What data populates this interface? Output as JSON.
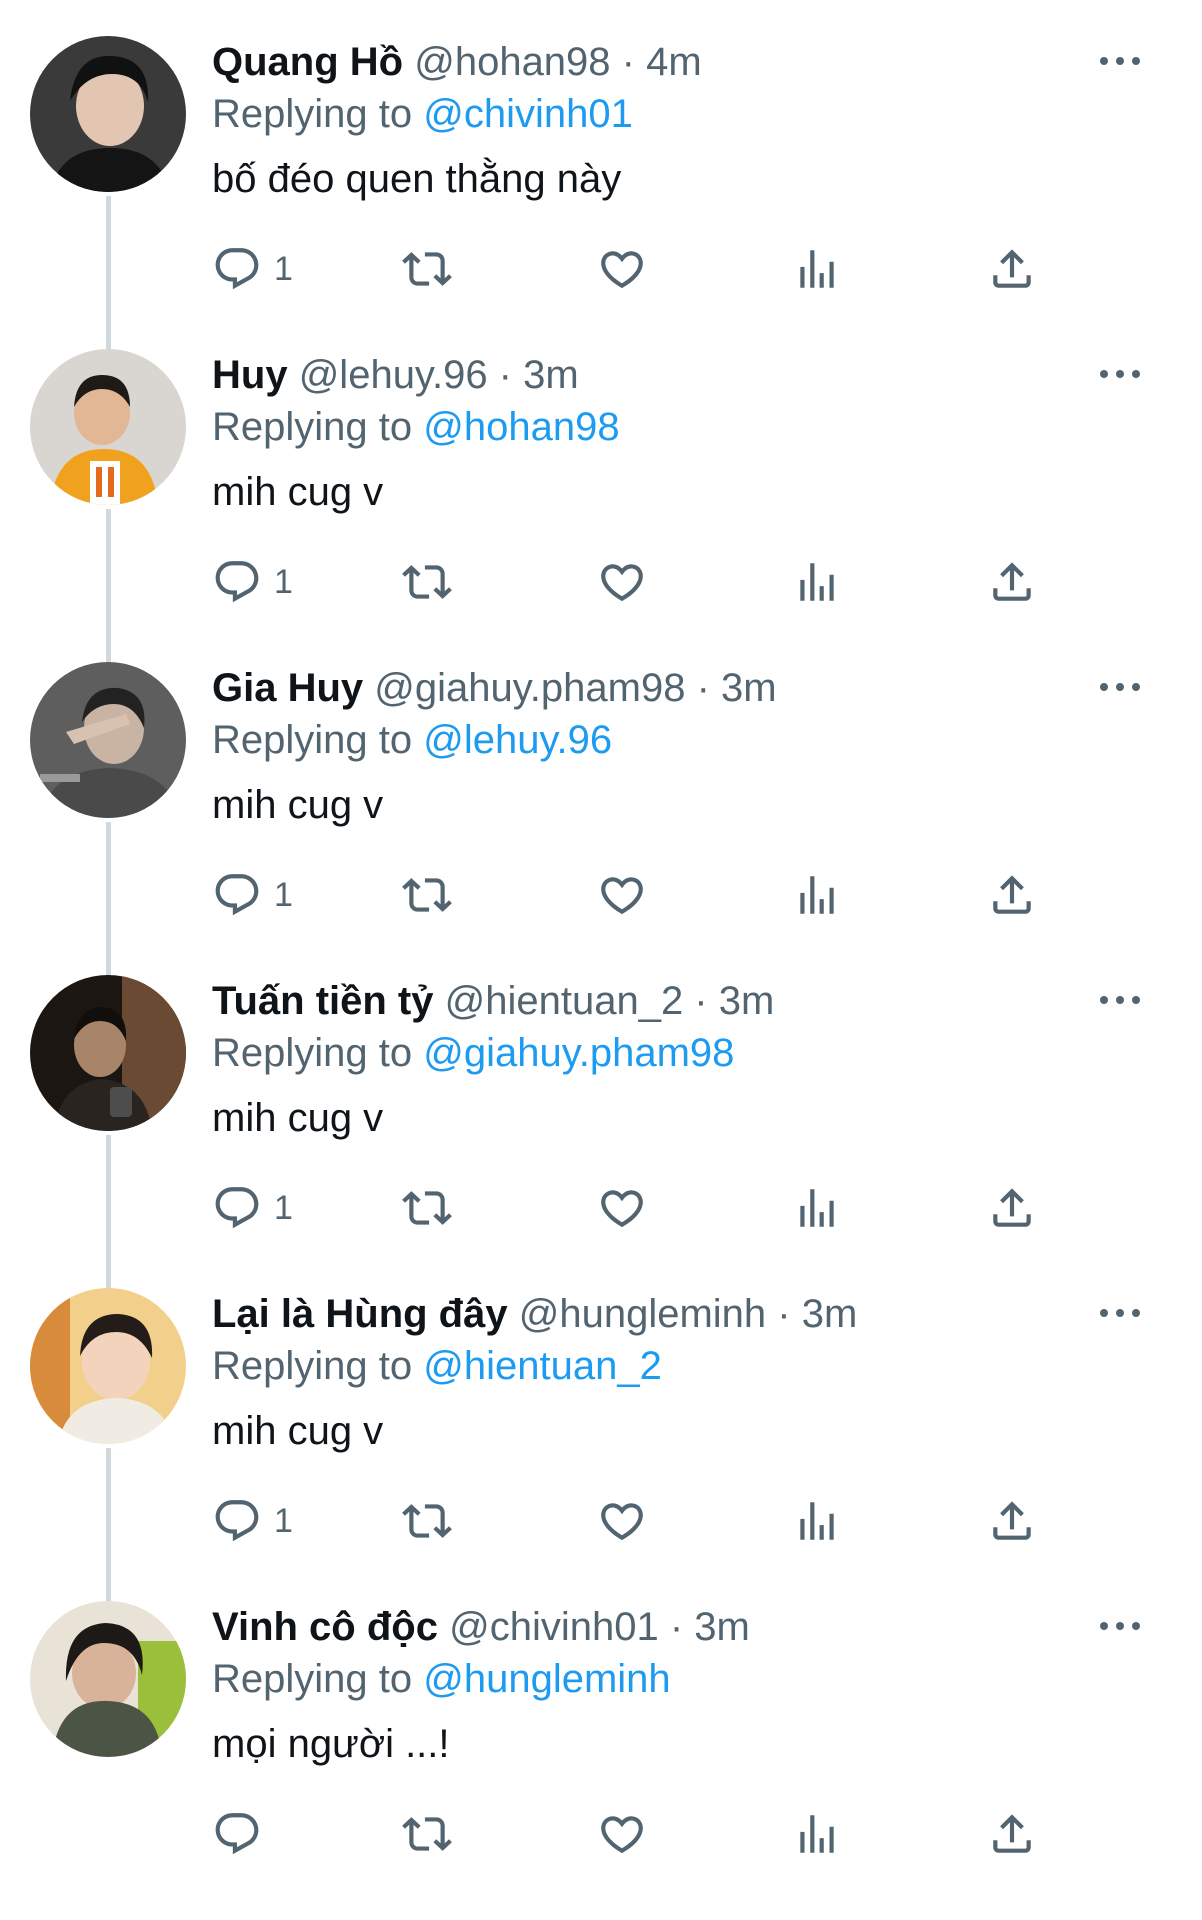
{
  "replying_prefix": "Replying to",
  "icons": {
    "reply": "speech-bubble-icon",
    "retweet": "retweet-arrows-icon",
    "like": "heart-icon",
    "views": "bar-chart-icon",
    "share": "share-upload-icon",
    "more": "more-horizontal-dots-icon"
  },
  "colors": {
    "link": "#1d9bf0",
    "secondary": "#536471",
    "primary_text": "#0f1419"
  },
  "tweets": [
    {
      "name": "Quang Hồ",
      "handle": "@hohan98 · 4m",
      "replying_to": "@chivinh01",
      "text": "bố đéo quen thằng này",
      "reply_count": "1"
    },
    {
      "name": "Huy",
      "handle": "@lehuy.96 · 3m",
      "replying_to": "@hohan98",
      "text": "mih cug v",
      "reply_count": "1"
    },
    {
      "name": "Gia Huy",
      "handle": "@giahuy.pham98 · 3m",
      "replying_to": "@lehuy.96",
      "text": "mih cug v",
      "reply_count": "1"
    },
    {
      "name": "Tuấn tiền tỷ",
      "handle": "@hientuan_2 · 3m",
      "replying_to": "@giahuy.pham98",
      "text": "mih cug v",
      "reply_count": "1"
    },
    {
      "name": "Lại là Hùng đây",
      "handle": "@hungleminh · 3m",
      "replying_to": "@hientuan_2",
      "text": "mih cug v",
      "reply_count": "1"
    },
    {
      "name": "Vinh cô độc",
      "handle": "@chivinh01 · 3m",
      "replying_to": "@hungleminh",
      "text": "mọi người ...!",
      "reply_count": ""
    }
  ]
}
